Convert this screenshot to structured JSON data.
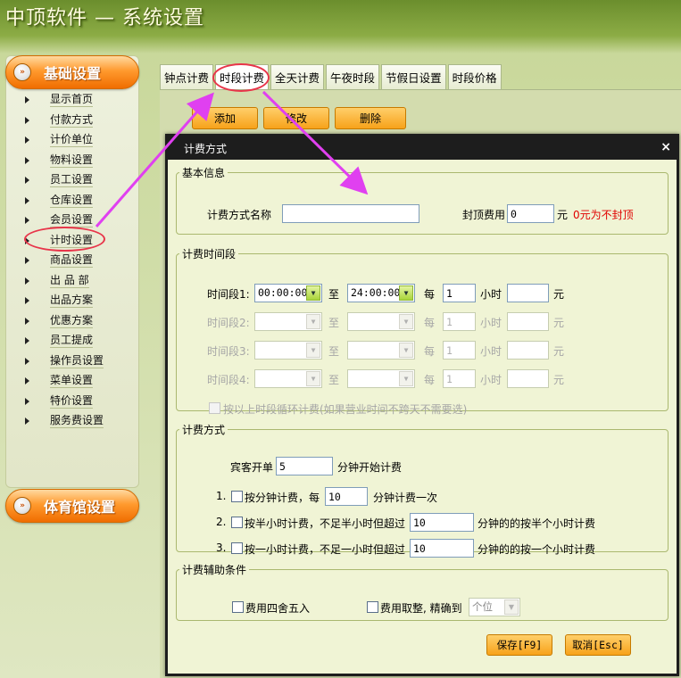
{
  "app": {
    "title": "中顶软件 — 系统设置"
  },
  "sidebar": {
    "section1": "基础设置",
    "section2": "体育馆设置",
    "items": [
      "显示首页",
      "付款方式",
      "计价单位",
      "物料设置",
      "员工设置",
      "仓库设置",
      "会员设置",
      "计时设置",
      "商品设置",
      "出 品 部",
      "出品方案",
      "优惠方案",
      "员工提成",
      "操作员设置",
      "菜单设置",
      "特价设置",
      "服务费设置"
    ],
    "selected": "计时设置"
  },
  "tabs": [
    "钟点计费",
    "时段计费",
    "全天计费",
    "午夜时段",
    "节假日设置",
    "时段价格"
  ],
  "active_tab": "时段计费",
  "toolbar": {
    "add": "添加",
    "edit": "修改",
    "delete": "删除"
  },
  "dialog": {
    "title": "计费方式",
    "close": "×",
    "basic": {
      "legend": "基本信息",
      "name_label": "计费方式名称",
      "name_value": "",
      "cap_label": "封顶费用",
      "cap_value": "0",
      "cap_unit": "元",
      "cap_hint": "0元为不封顶"
    },
    "periods": {
      "legend": "计费时间段",
      "rows": [
        {
          "label": "时间段1:",
          "start": "00:00:00",
          "to": "至",
          "end": "24:00:00",
          "every": "每",
          "hours": "1",
          "hour_unit": "小时",
          "price": "",
          "price_unit": "元"
        },
        {
          "label": "时间段2:",
          "start": "",
          "to": "至",
          "end": "",
          "every": "每",
          "hours": "1",
          "hour_unit": "小时",
          "price": "",
          "price_unit": "元"
        },
        {
          "label": "时间段3:",
          "start": "",
          "to": "至",
          "end": "",
          "every": "每",
          "hours": "1",
          "hour_unit": "小时",
          "price": "",
          "price_unit": "元"
        },
        {
          "label": "时间段4:",
          "start": "",
          "to": "至",
          "end": "",
          "every": "每",
          "hours": "1",
          "hour_unit": "小时",
          "price": "",
          "price_unit": "元"
        }
      ],
      "cycle_label": "按以上时段循环计费(如果营业时间不跨天不需要选)"
    },
    "method": {
      "legend": "计费方式",
      "open_label": "宾客开单",
      "open_value": "5",
      "open_suffix": "分钟开始计费",
      "opt1_num": "1.",
      "opt1_label": "按分钟计费，每",
      "opt1_value": "10",
      "opt1_suffix": "分钟计费一次",
      "opt2_num": "2.",
      "opt2_label": "按半小时计费，不足半小时但超过",
      "opt2_value": "10",
      "opt2_suffix": "分钟的的按半个小时计费",
      "opt3_num": "3.",
      "opt3_label": "按一小时计费，不足一小时但超过",
      "opt3_value": "10",
      "opt3_suffix": "分钟的的按一个小时计费"
    },
    "aux": {
      "legend": "计费辅助条件",
      "round_label": "费用四舍五入",
      "trunc_label": "费用取整, 精确到",
      "trunc_value": "个位"
    },
    "save": "保存[F9]",
    "cancel": "取消[Esc]"
  },
  "colors": {
    "accent_orange": "#f7a21a",
    "highlight": "#e8354a",
    "arrow": "#e040f0",
    "hint_red": "#e00000"
  }
}
